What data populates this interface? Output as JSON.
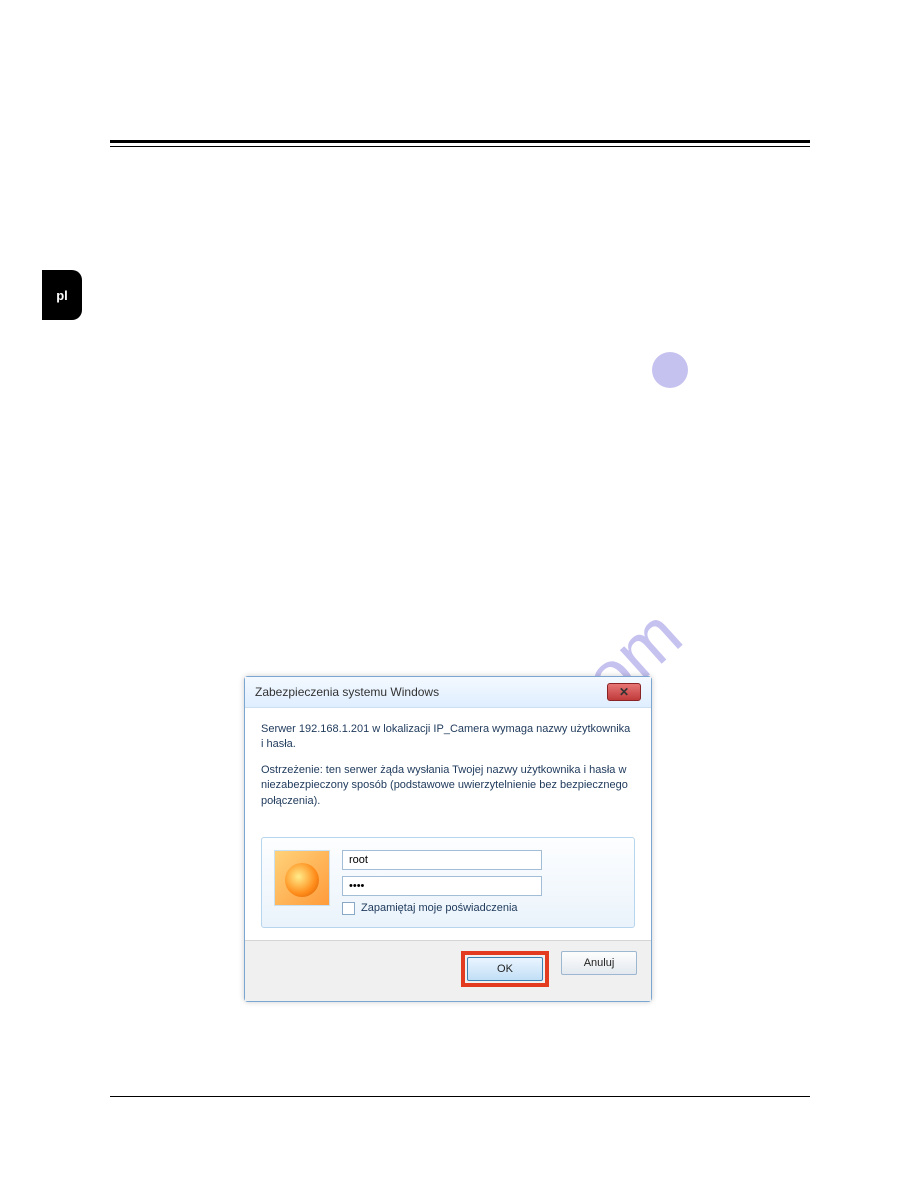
{
  "page": {
    "lang_tab": "pl"
  },
  "dialog": {
    "title": "Zabezpieczenia systemu Windows",
    "close_glyph": "✕",
    "msg1": "Serwer 192.168.1.201 w lokalizacji IP_Camera wymaga nazwy użytkownika i hasła.",
    "msg2": "Ostrzeżenie: ten serwer żąda wysłania Twojej nazwy użytkownika i hasła w niezabezpieczony sposób (podstawowe uwierzytelnienie bez bezpiecznego połączenia).",
    "username": "root",
    "password_mask": "••••",
    "remember_label": "Zapamiętaj moje poświadczenia",
    "ok_label": "OK",
    "cancel_label": "Anuluj"
  },
  "watermark": {
    "text": "manualshive.com"
  }
}
